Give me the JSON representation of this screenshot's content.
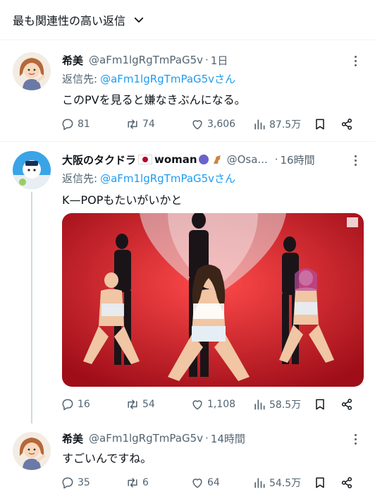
{
  "sort": {
    "label": "最も関連性の高い返信"
  },
  "tweets": [
    {
      "name": "希美",
      "handle": "@aFm1lgRgTmPaG5v",
      "dot": "·",
      "time": "1日",
      "reply_prefix": "返信先:",
      "reply_mention": "@aFm1lgRgTmPaG5vさん",
      "text": "このPVを見ると嫌なきぶんになる。",
      "replies": "81",
      "retweets": "74",
      "likes": "3,606",
      "views": "87.5万"
    },
    {
      "name": "大阪のタクドラ",
      "name_suffix": "woman",
      "handle": "@Osa...",
      "dot": "·",
      "time": "16時間",
      "reply_prefix": "返信先:",
      "reply_mention": "@aFm1lgRgTmPaG5vさん",
      "text": "K—POPもたいがいかと",
      "replies": "16",
      "retweets": "54",
      "likes": "1,108",
      "views": "58.5万"
    },
    {
      "name": "希美",
      "handle": "@aFm1lgRgTmPaG5v",
      "dot": "·",
      "time": "14時間",
      "text": "すごいんですね。",
      "replies": "35",
      "retweets": "6",
      "likes": "64",
      "views": "54.5万"
    }
  ],
  "colors": {
    "text": "#0f1419",
    "secondary": "#536471",
    "link": "#1d9bf0",
    "divider": "#eff3f4",
    "media_bg": "#c81d2a"
  },
  "icons": [
    "chevron-down-icon",
    "more-icon",
    "reply-icon",
    "retweet-icon",
    "like-icon",
    "views-icon",
    "bookmark-icon",
    "share-icon"
  ]
}
